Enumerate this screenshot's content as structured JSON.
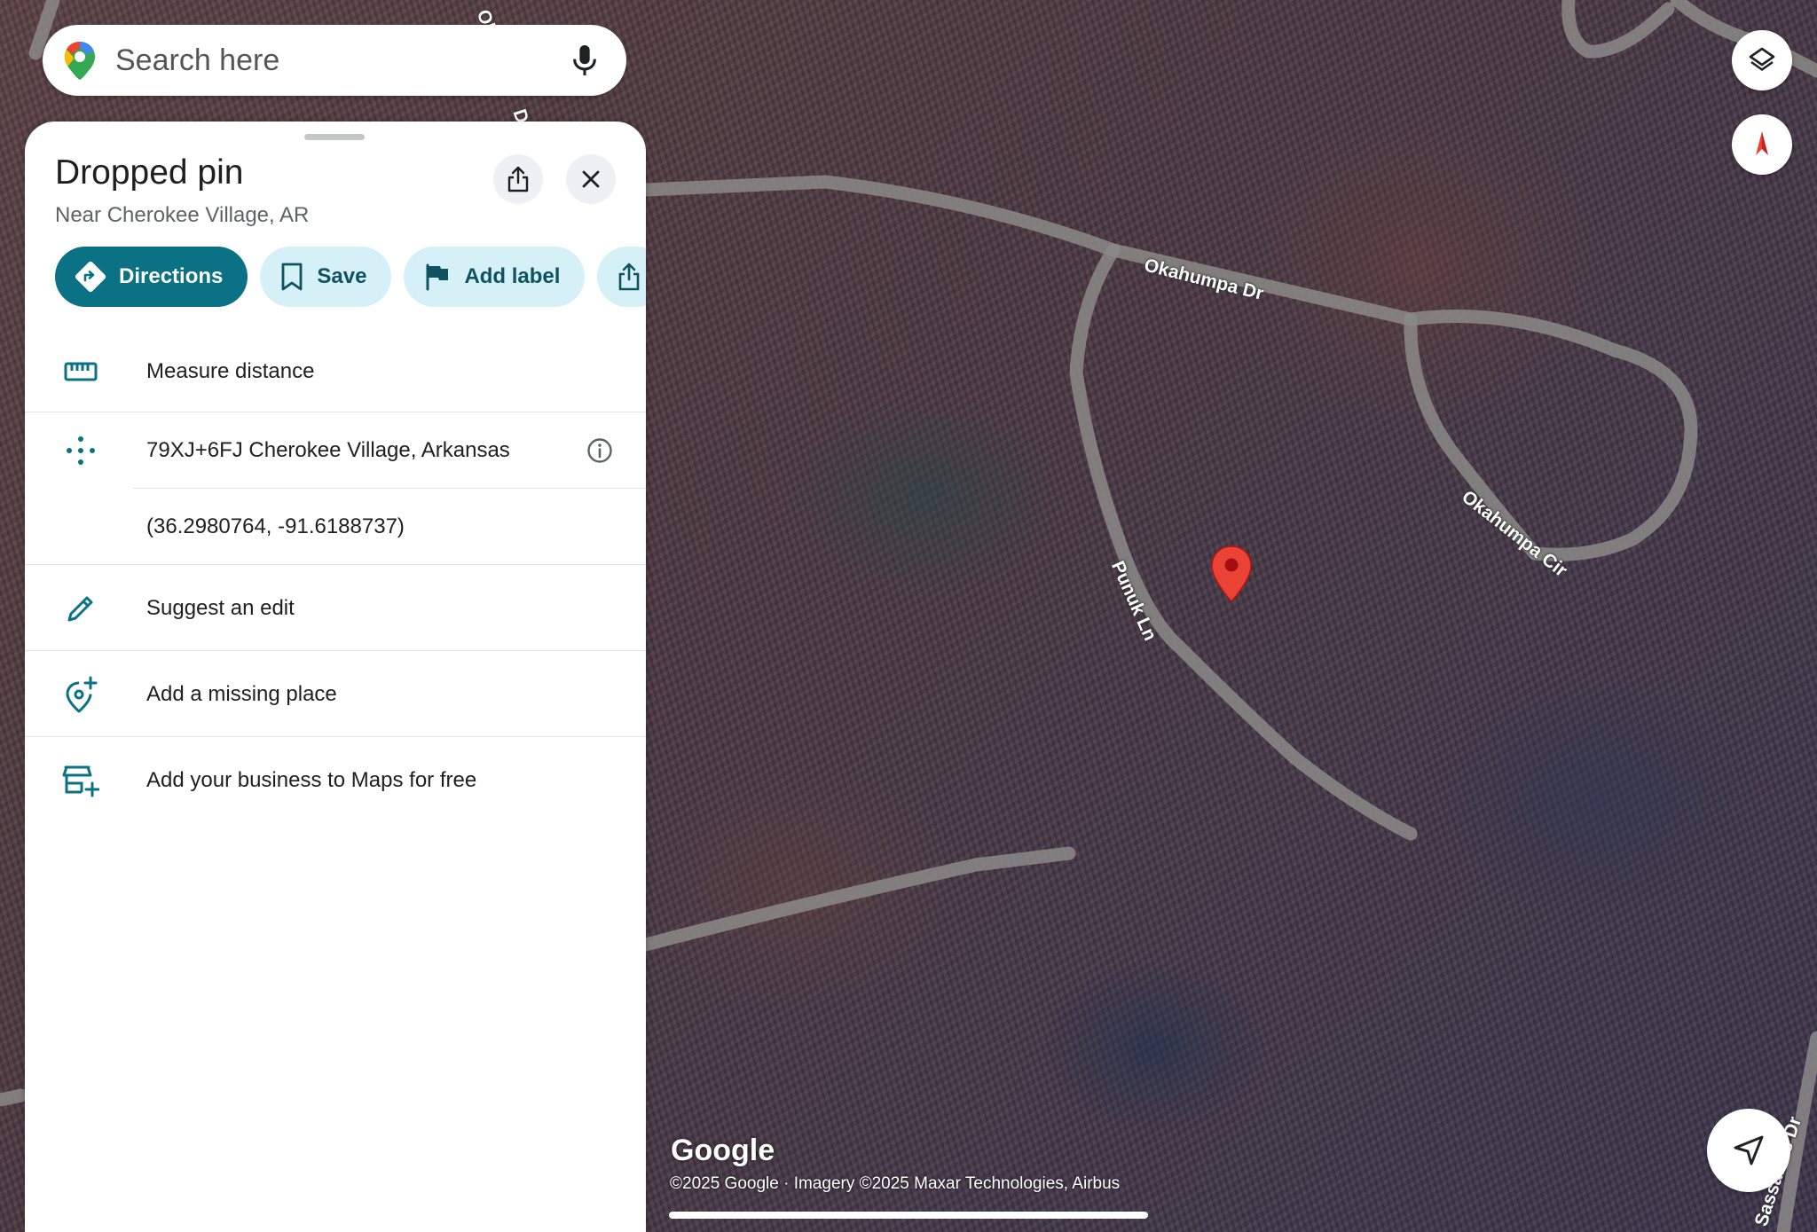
{
  "search": {
    "placeholder": "Search here"
  },
  "panel": {
    "title": "Dropped pin",
    "subtitle": "Near Cherokee Village, AR",
    "actions": [
      {
        "label": "Directions",
        "icon": "directions-icon"
      },
      {
        "label": "Save",
        "icon": "bookmark-icon"
      },
      {
        "label": "Add label",
        "icon": "flag-icon"
      },
      {
        "label": "",
        "icon": "share-icon"
      }
    ],
    "rows": {
      "measure": "Measure distance",
      "plus_code": "79XJ+6FJ Cherokee Village, Arkansas",
      "coordinates": "(36.2980764, -91.6188737)",
      "suggest_edit": "Suggest an edit",
      "add_place": "Add a missing place",
      "add_business": "Add your business to Maps for free"
    }
  },
  "map": {
    "road_labels": {
      "okahumpa_dr": "Okahumpa Dr",
      "okahumpa_cir": "Okahumpa Cir",
      "punuk_ln": "Punuk Ln",
      "sassafras_dr": "Sassafras Dr",
      "top_fragment": "Ok",
      "top_fragment_2": "Dr"
    },
    "logo": "Google",
    "attribution": "©2025 Google · Imagery ©2025 Maxar Technologies, Airbus"
  },
  "colors": {
    "accent": "#0b7285",
    "chip_bg": "#d5f1f7",
    "pin": "#ea4335"
  }
}
